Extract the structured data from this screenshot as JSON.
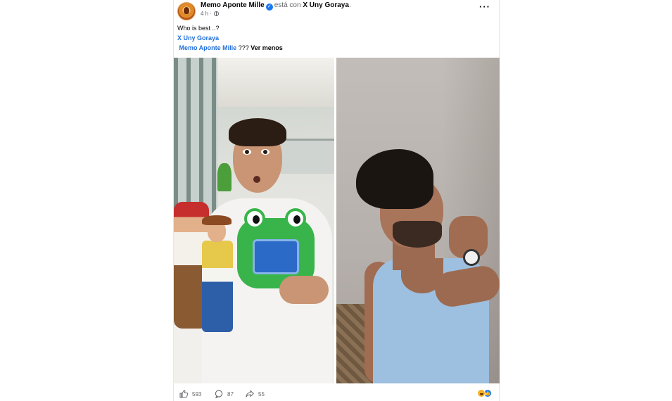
{
  "post": {
    "author": "Memo Aponte Mille",
    "with_text": "está con",
    "tagged": "X Uny Goraya",
    "tagged_suffix": ".",
    "time": "4 h",
    "time_sep": "·",
    "more_label": "···",
    "caption": {
      "line1": "Who is best ..?",
      "mention1": "X Uny Goraya",
      "mention2": "Memo Aponte Mille",
      "line3_text": "???",
      "see_less": "Ver menos"
    },
    "photos": [
      {
        "name": "photo-left"
      },
      {
        "name": "photo-right"
      }
    ],
    "footer": {
      "likes": "593",
      "comments": "87",
      "shares": "55"
    }
  },
  "colors": {
    "link": "#216fdb",
    "meta": "#65676b",
    "verified": "#1877f2"
  },
  "icons": [
    "verified-icon",
    "globe-icon",
    "more-icon",
    "like-icon",
    "comment-icon",
    "share-icon",
    "haha-reaction-icon",
    "like-reaction-icon"
  ]
}
